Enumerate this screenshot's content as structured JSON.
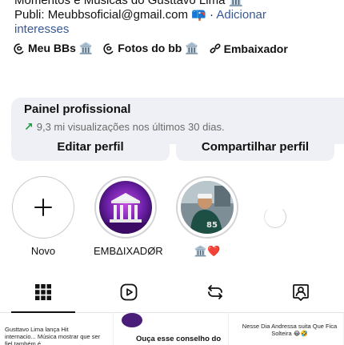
{
  "bio": {
    "line_cut": "Momentos e Músicas do Gusttavo Lima 🏛️",
    "publi_prefix": "Publi: Meubbsoficial@gmail.com 📪 ·",
    "add_interests": "Adicionar",
    "add_interests_2": "interesses"
  },
  "chips": [
    {
      "label": "Meu BBs 🏛️",
      "icon": "threads-icon"
    },
    {
      "label": "Fotos do bb 🏛️",
      "icon": "threads-icon"
    },
    {
      "label": "Embaixador",
      "icon": "link-icon"
    }
  ],
  "panel": {
    "title": "Painel profissional",
    "stats": "9,3 mi visualizações nos últimos 30 dias."
  },
  "buttons": {
    "edit": "Editar perfil",
    "share": "Compartilhar perfil"
  },
  "stories": [
    {
      "label": "Novo"
    },
    {
      "label": "EMBΔIXADØR"
    },
    {
      "label": "🏛️❤️"
    }
  ],
  "tabs": [
    {
      "name": "grid",
      "icon": "grid-icon",
      "active": true
    },
    {
      "name": "reels",
      "icon": "reels-icon",
      "active": false
    },
    {
      "name": "reposts",
      "icon": "repost-icon",
      "active": false
    },
    {
      "name": "tagged",
      "icon": "tagged-icon",
      "active": false
    }
  ],
  "posts": [
    {
      "text": "Gusttavo Lima lança Hit internacio... Música mostrar que ser fiel também é"
    },
    {
      "text": "Ouça esse conselho do"
    },
    {
      "text": "Nesse Dia Andressa suita Que Fica Solteira 😂🤣"
    }
  ],
  "colors": {
    "panel_bg": "#eff0f5",
    "growth_arrow": "#1c9b3a",
    "link": "#385898"
  }
}
